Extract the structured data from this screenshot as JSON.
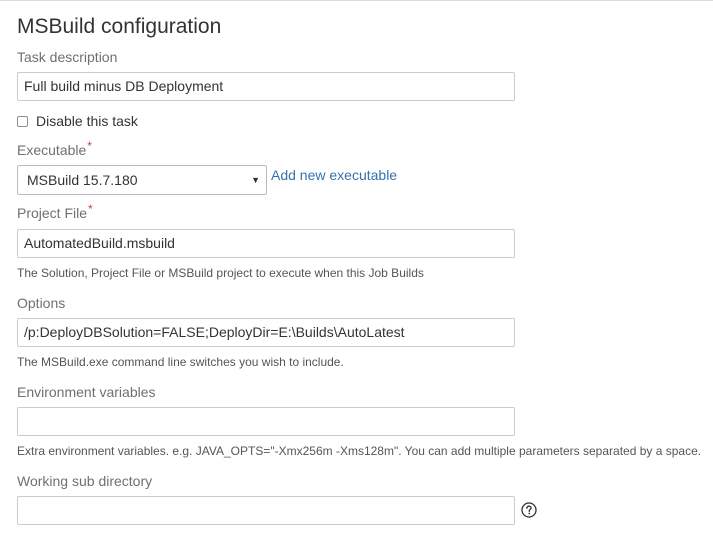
{
  "page": {
    "title": "MSBuild configuration"
  },
  "task_description": {
    "label": "Task description",
    "value": "Full build minus DB Deployment"
  },
  "disable_task": {
    "label": "Disable this task",
    "checked": false
  },
  "executable": {
    "label": "Executable",
    "required": "*",
    "selected": "MSBuild 15.7.180",
    "add_link": "Add new executable",
    "arrow": "▼"
  },
  "project_file": {
    "label": "Project File",
    "required": "*",
    "value": "AutomatedBuild.msbuild",
    "help": "The Solution, Project File or MSBuild project to execute when this Job Builds"
  },
  "options": {
    "label": "Options",
    "value": "/p:DeployDBSolution=FALSE;DeployDir=E:\\Builds\\AutoLatest",
    "help": "The MSBuild.exe command line switches you wish to include."
  },
  "environment_variables": {
    "label": "Environment variables",
    "value": "",
    "help": "Extra environment variables. e.g. JAVA_OPTS=\"-Xmx256m -Xms128m\". You can add multiple parameters separated by a space."
  },
  "working_sub_directory": {
    "label": "Working sub directory",
    "value": "",
    "help_icon": "question-circle-icon"
  },
  "colors": {
    "link": "#3572b0",
    "required": "#d04437",
    "label": "#707070"
  }
}
